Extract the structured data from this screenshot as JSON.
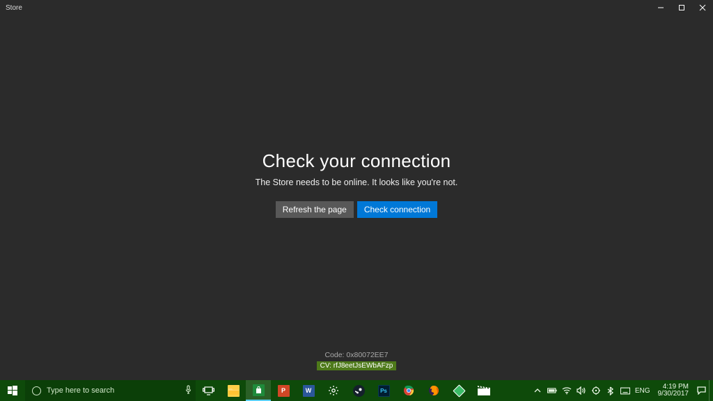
{
  "window": {
    "title": "Store",
    "headline": "Check your connection",
    "subtext": "The Store needs to be online. It looks like you're not.",
    "refresh_label": "Refresh the page",
    "check_label": "Check connection",
    "code_line": "Code: 0x80072EE7",
    "cv_line": "CV: rfJ8eetJsEWbAFzp"
  },
  "taskbar": {
    "search_placeholder": "Type here to search",
    "lang": "ENG",
    "time": "4:19 PM",
    "date": "9/30/2017"
  }
}
